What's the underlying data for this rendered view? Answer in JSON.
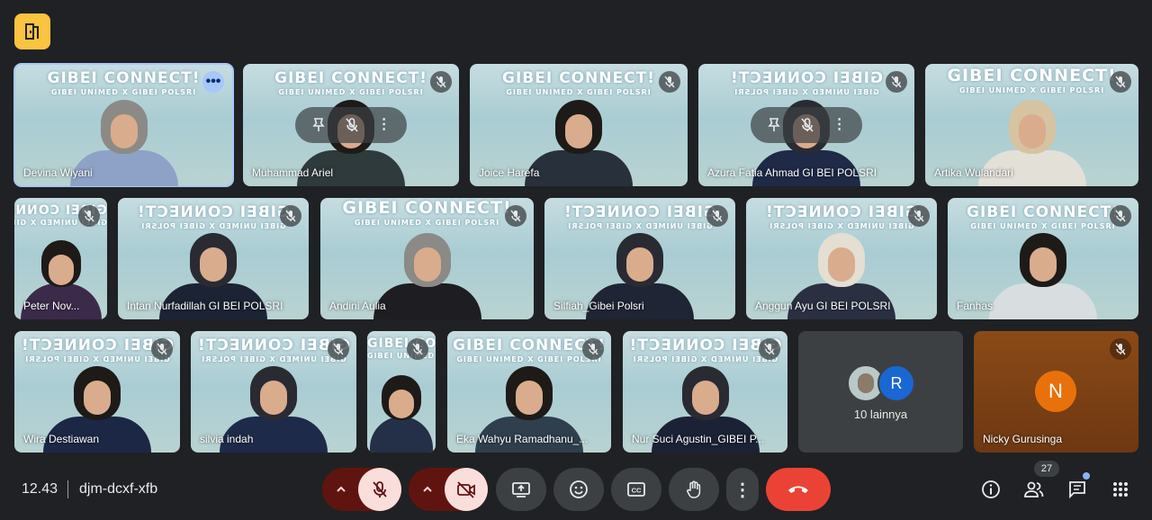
{
  "meeting": {
    "time": "12.43",
    "code": "djm-dcxf-xfb",
    "participant_count": "27"
  },
  "banner": {
    "title": "GIBEI CONNECT!",
    "subtitle": "GIBEI UNIMED X GIBEI POLSRI"
  },
  "participants": [
    {
      "name": "Devina Wiyani"
    },
    {
      "name": "Muhammad Ariel"
    },
    {
      "name": "Joice Harefa"
    },
    {
      "name": "Azura Fatia Ahmad GI BEI POLSRI"
    },
    {
      "name": "Artika Wulandari"
    },
    {
      "name": "Peter Nov..."
    },
    {
      "name": "Intan Nurfadillah GI BEI POLSRI"
    },
    {
      "name": "Andini Aulia"
    },
    {
      "name": "Silfiah_Gibei Polsri"
    },
    {
      "name": "Anggun Ayu GI BEI POLSRI"
    },
    {
      "name": "Fanhas"
    },
    {
      "name": "Wira Destiawan"
    },
    {
      "name": "silvia indah"
    },
    {
      "name": ""
    },
    {
      "name": "Eka Wahyu Ramadhanu_..."
    },
    {
      "name": "Nur Suci Agustin_GIBEI P..."
    },
    {
      "name": "Nicky Gurusinga",
      "initial": "N"
    }
  ],
  "others": {
    "label": "10 lainnya",
    "initial": "R"
  },
  "icons": {
    "logo": "door-icon",
    "more": "more-horiz-icon",
    "muted": "mic-off-icon",
    "pin": "pin-icon",
    "chevron": "chevron-up-icon",
    "camera_off": "videocam-off-icon",
    "present": "present-screen-icon",
    "emoji": "emoji-icon",
    "captions": "captions-icon",
    "hand": "raise-hand-icon",
    "end": "call-end-icon",
    "info": "info-icon",
    "people": "people-icon",
    "chat": "chat-icon",
    "apps": "apps-grid-icon"
  },
  "colors": {
    "background": "#202124",
    "end_call": "#ea4335",
    "mic_active": "#f9dedc",
    "accent": "#a8c7fa",
    "avatar_n": "#e8710a",
    "avatar_r": "#1967d2"
  }
}
